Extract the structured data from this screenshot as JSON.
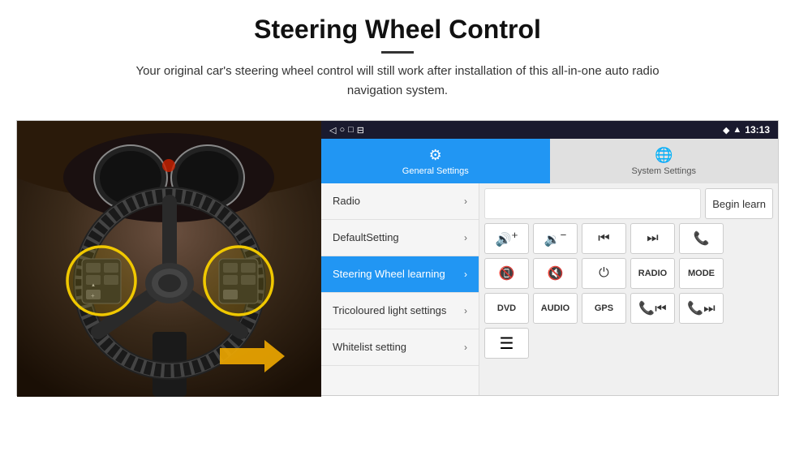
{
  "header": {
    "title": "Steering Wheel Control",
    "subtitle": "Your original car's steering wheel control will still work after installation of this all-in-one auto radio navigation system."
  },
  "android": {
    "statusBar": {
      "time": "13:13",
      "icons": [
        "◄",
        "●",
        "■",
        "⊕"
      ]
    },
    "navBar": {
      "icons": [
        "◁",
        "○",
        "□",
        "⊟"
      ]
    },
    "tabs": [
      {
        "id": "general",
        "label": "General Settings",
        "icon": "⚙",
        "active": true
      },
      {
        "id": "system",
        "label": "System Settings",
        "icon": "🌐",
        "active": false
      }
    ],
    "menuItems": [
      {
        "id": "radio",
        "label": "Radio",
        "active": false
      },
      {
        "id": "default",
        "label": "DefaultSetting",
        "active": false
      },
      {
        "id": "steering",
        "label": "Steering Wheel learning",
        "active": true
      },
      {
        "id": "tricoloured",
        "label": "Tricoloured light settings",
        "active": false
      },
      {
        "id": "whitelist",
        "label": "Whitelist setting",
        "active": false
      }
    ],
    "controls": {
      "beginLearnLabel": "Begin learn",
      "row2Buttons": [
        "🔊+",
        "🔊−",
        "⏮",
        "⏭",
        "📞"
      ],
      "row3Buttons": [
        "↩",
        "🔇",
        "⏻",
        "RADIO",
        "MODE"
      ],
      "row4Buttons": [
        "DVD",
        "AUDIO",
        "GPS",
        "📞⏮",
        "📞⏭"
      ]
    }
  }
}
